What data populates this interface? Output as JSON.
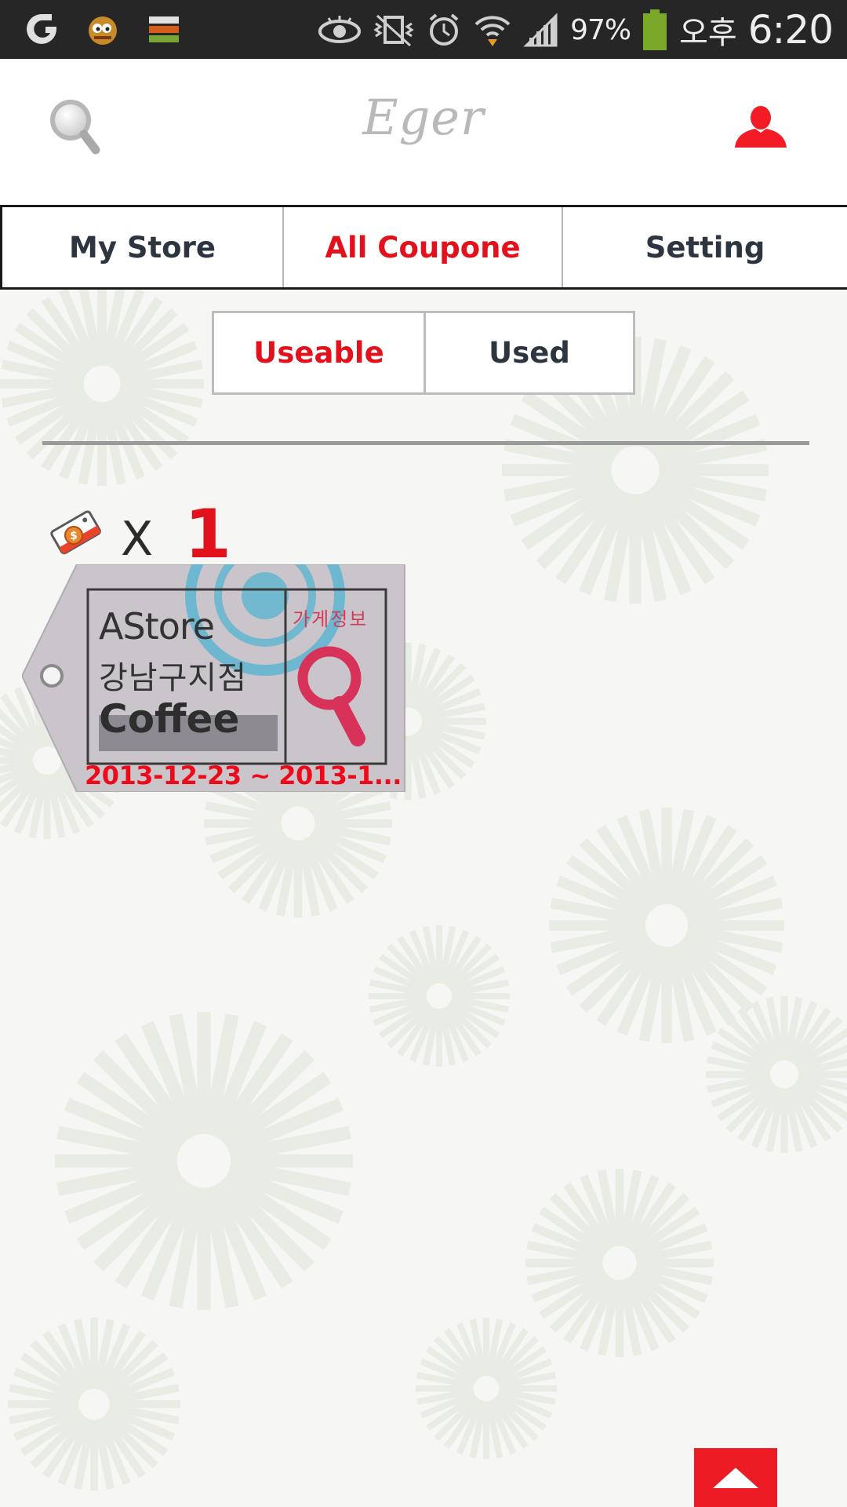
{
  "status_bar": {
    "battery_percent": "97%",
    "ampm": "오후",
    "time": "6:20",
    "icons": [
      "g-app-icon",
      "mascot-app-icon",
      "stack-app-icon",
      "eye-icon",
      "vibrate-icon",
      "alarm-icon",
      "wifi-icon",
      "signal-icon",
      "battery-icon"
    ]
  },
  "header": {
    "title": "Eger",
    "search_icon": "search-icon",
    "profile_icon": "user-icon",
    "accent_color": "#e3111b"
  },
  "tabs": [
    {
      "label": "My Store",
      "active": false
    },
    {
      "label": "All Coupone",
      "active": true
    },
    {
      "label": "Setting",
      "active": false
    }
  ],
  "subtabs": [
    {
      "label": "Useable",
      "active": true
    },
    {
      "label": "Used",
      "active": false
    }
  ],
  "coupon_count": {
    "icon": "coupon-tag-icon",
    "multiplier": "X",
    "count": "1"
  },
  "coupons": [
    {
      "store": "AStore",
      "branch": "강남구지점",
      "category": "Coffee",
      "info_label": "가게정보",
      "date_range": "2013-12-23 ~ 2013-1..."
    }
  ],
  "scroll_top_icon": "arrow-up-icon"
}
